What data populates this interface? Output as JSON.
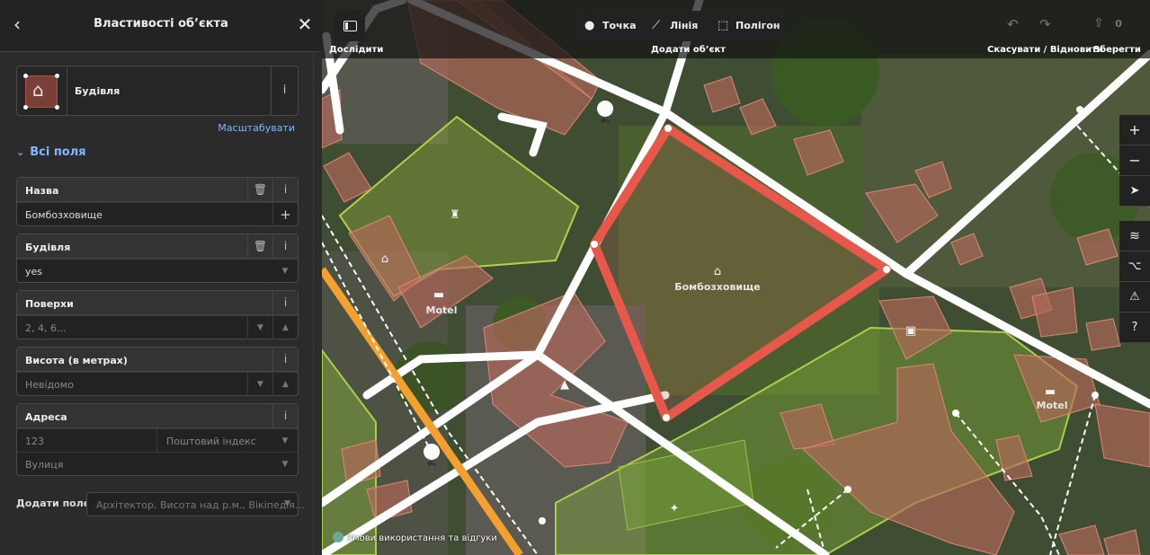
{
  "sidebar": {
    "title": "Властивості об’єкта",
    "back_icon": "‹",
    "close_icon": "✕",
    "preset": {
      "name": "Будівля",
      "info": "i"
    },
    "zoom_link": "Масштабувати",
    "all_fields": "Всі поля",
    "fields": {
      "name": {
        "label": "Назва",
        "value": "Бомбозховище",
        "add": "+"
      },
      "building": {
        "label": "Будівля",
        "value": "yes"
      },
      "levels": {
        "label": "Поверхи",
        "placeholder": "2, 4, 6..."
      },
      "height": {
        "label": "Висота (в метрах)",
        "placeholder": "Невідомо"
      },
      "address": {
        "label": "Адреса",
        "housenumber_placeholder": "123",
        "postcode_placeholder": "Поштовий індекс",
        "street_placeholder": "Вулиця"
      }
    },
    "add_field": {
      "label": "Додати поле:",
      "placeholder": "Архітектор, Висота над р.м., Вікіпедія..."
    }
  },
  "toolbar": {
    "inspect_label": "Дослідити",
    "point_label": "Точка",
    "line_label": "Лінія",
    "polygon_label": "Полігон",
    "add_feature_label": "Додати об’єкт",
    "undo_redo_label": "Скасувати / Відновити",
    "save_label": "Зберегти",
    "save_count": "0"
  },
  "map": {
    "feature_label": "Бомбозховище",
    "motel_label_1": "Motel",
    "motel_label_2": "Motel",
    "terms": "Умови використання та відгуки"
  },
  "colors": {
    "selected_outline": "#e8584a",
    "building_fill": "#b5685a",
    "park_fill": "#8fbf3a",
    "road": "#ffffff",
    "primary_road": "#f4a030"
  }
}
